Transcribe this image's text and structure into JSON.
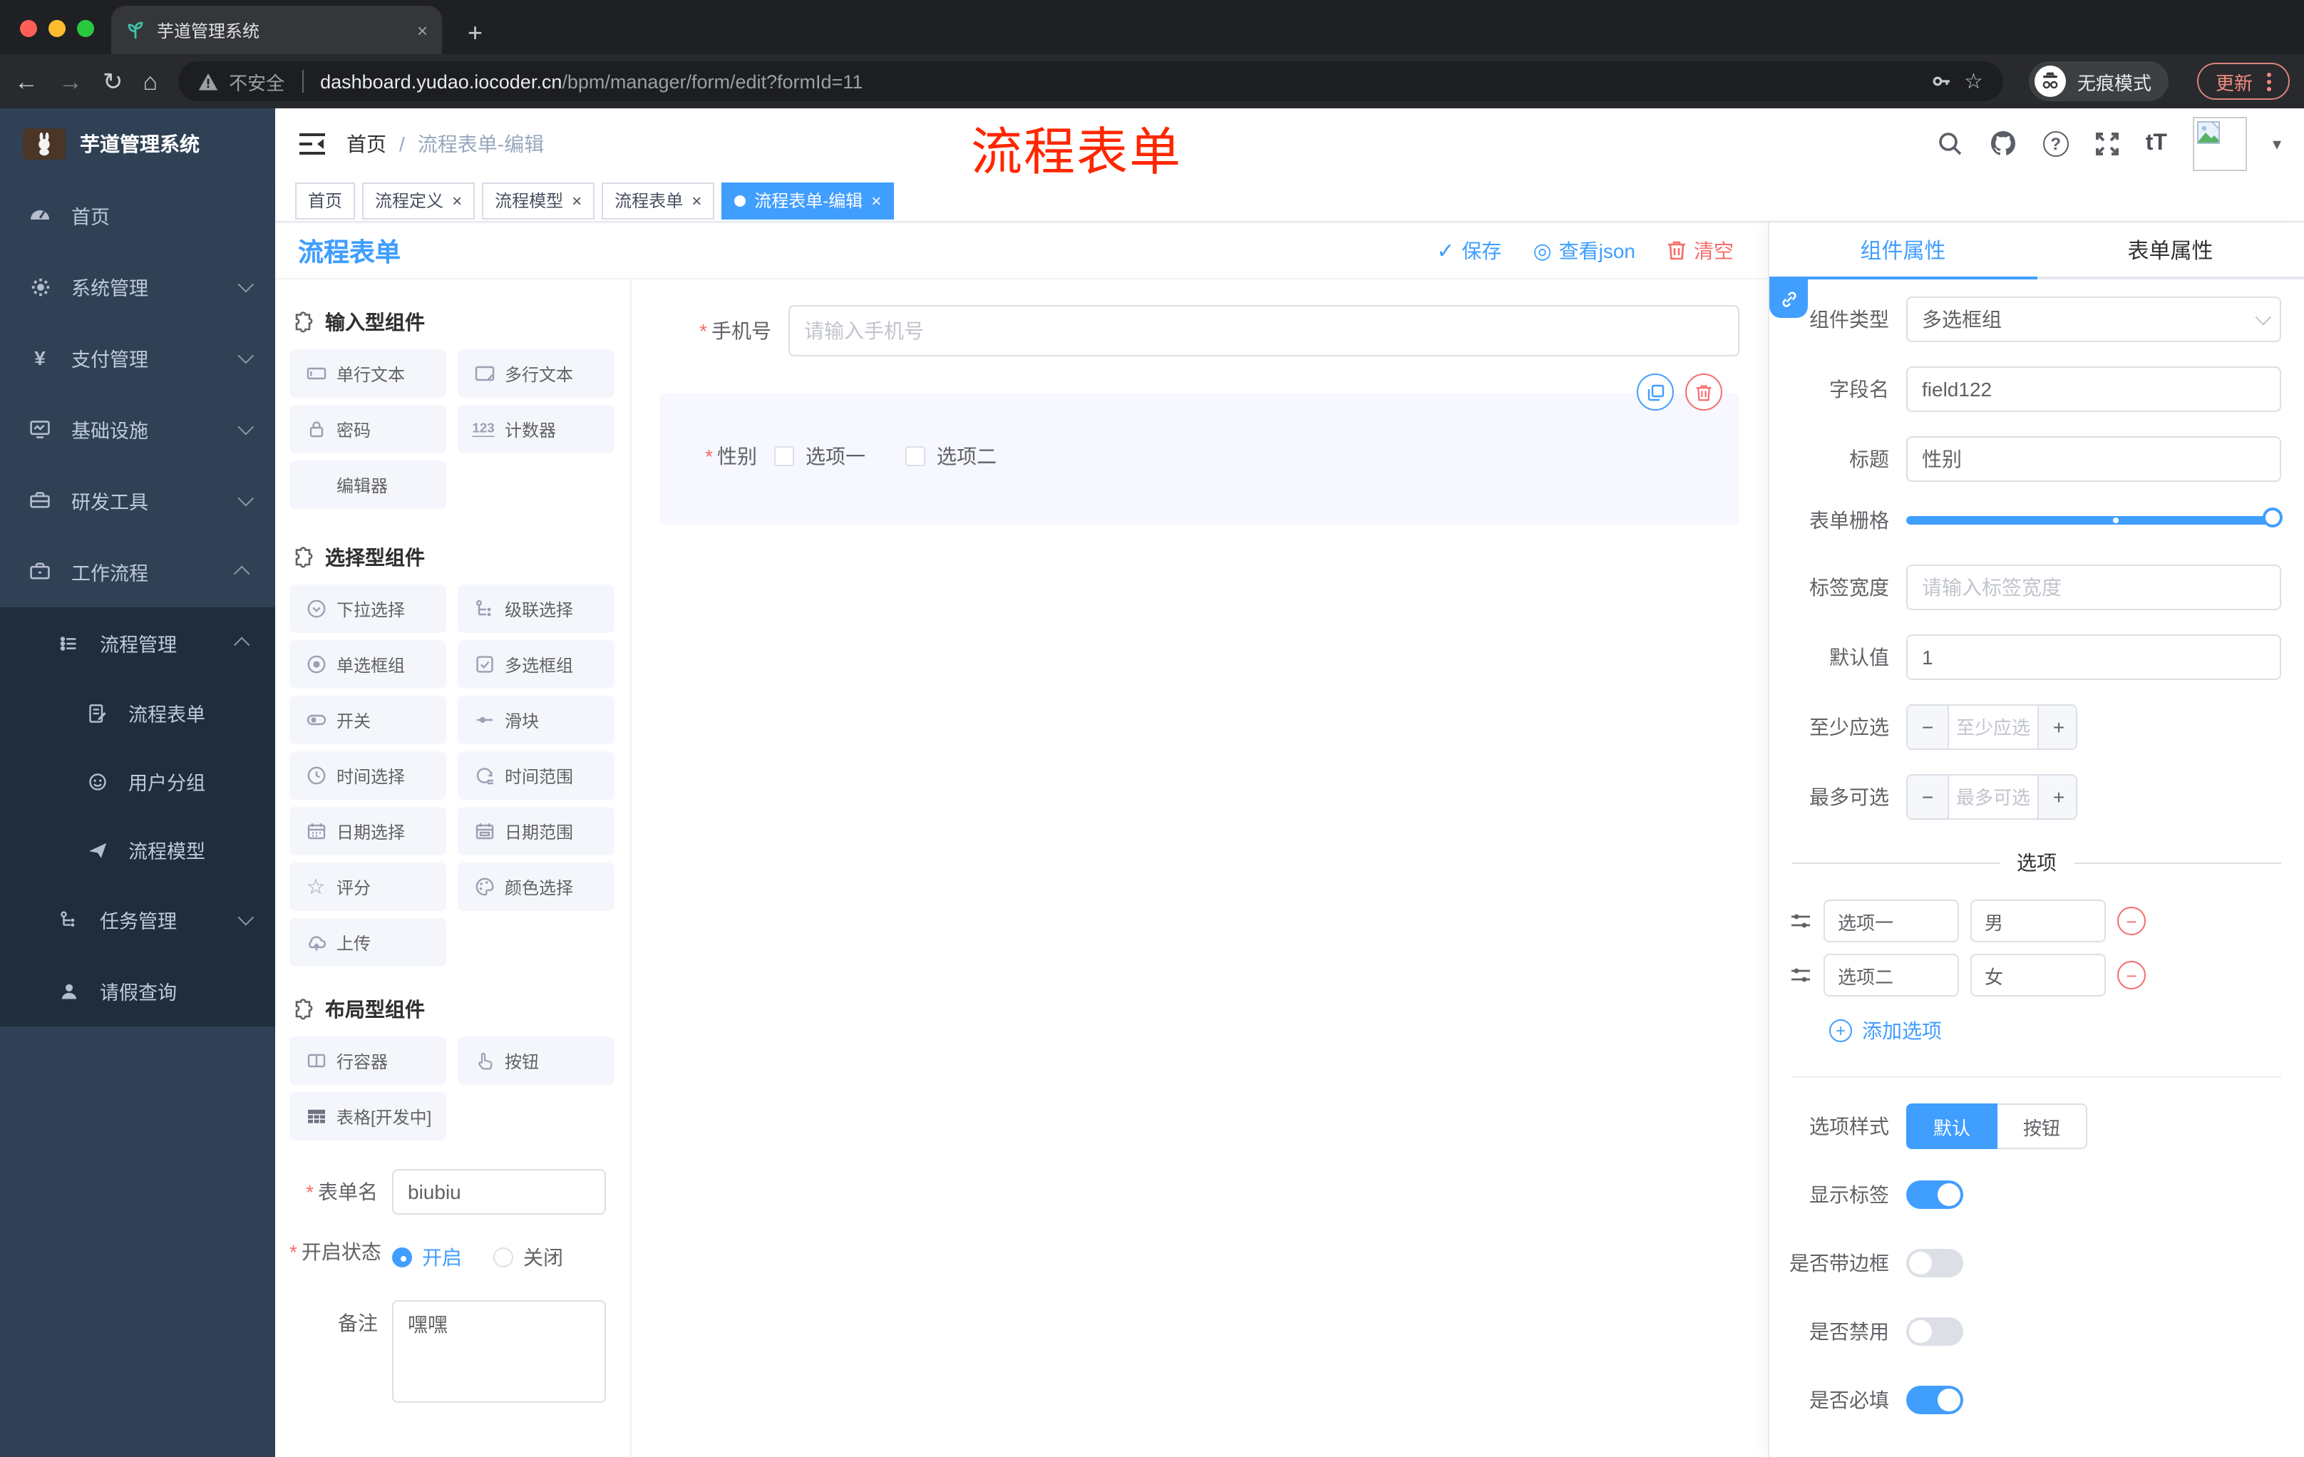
{
  "browser": {
    "tab_title": "芋道管理系统",
    "security_label": "不安全",
    "url_domain": "dashboard.yudao.iocoder.cn",
    "url_path": "/bpm/manager/form/edit?formId=11",
    "incognito_label": "无痕模式",
    "update_label": "更新"
  },
  "annotation": {
    "text": "流程表单"
  },
  "sidebar": {
    "logo_title": "芋道管理系统",
    "menu": [
      {
        "label": "首页"
      },
      {
        "label": "系统管理"
      },
      {
        "label": "支付管理"
      },
      {
        "label": "基础设施"
      },
      {
        "label": "研发工具"
      },
      {
        "label": "工作流程"
      }
    ],
    "submenu": {
      "process_manage": "流程管理",
      "children": [
        "流程表单",
        "用户分组",
        "流程模型"
      ],
      "task_manage": "任务管理",
      "leave_query": "请假查询"
    }
  },
  "header": {
    "breadcrumb": [
      "首页",
      "流程表单-编辑"
    ]
  },
  "tags": {
    "items": [
      "首页",
      "流程定义",
      "流程模型",
      "流程表单",
      "流程表单-编辑"
    ]
  },
  "designer": {
    "title": "流程表单",
    "actions": {
      "save": "保存",
      "view_json": "查看json",
      "clear": "清空"
    },
    "palette": {
      "sections": [
        {
          "title": "输入型组件",
          "items": [
            "单行文本",
            "多行文本",
            "密码",
            "计数器",
            "编辑器"
          ]
        },
        {
          "title": "选择型组件",
          "items": [
            "下拉选择",
            "级联选择",
            "单选框组",
            "多选框组",
            "开关",
            "滑块",
            "时间选择",
            "时间范围",
            "日期选择",
            "日期范围",
            "评分",
            "颜色选择",
            "上传"
          ]
        },
        {
          "title": "布局型组件",
          "items": [
            "行容器",
            "按钮",
            "表格[开发中]"
          ]
        }
      ]
    },
    "form_meta": {
      "name_label": "表单名",
      "name_value": "biubiu",
      "status_label": "开启状态",
      "status_on": "开启",
      "status_off": "关闭",
      "remark_label": "备注",
      "remark_value": "嘿嘿"
    },
    "canvas": {
      "phone_label": "手机号",
      "phone_placeholder": "请输入手机号",
      "gender_label": "性别",
      "gender_options": [
        "选项一",
        "选项二"
      ]
    }
  },
  "properties": {
    "tabs": [
      "组件属性",
      "表单属性"
    ],
    "fields": {
      "type_label": "组件类型",
      "type_value": "多选框组",
      "field_label": "字段名",
      "field_value": "field122",
      "title_label": "标题",
      "title_value": "性别",
      "grid_label": "表单栅格",
      "label_width_label": "标签宽度",
      "label_width_placeholder": "请输入标签宽度",
      "default_label": "默认值",
      "default_value": "1",
      "min_label": "至少应选",
      "min_placeholder": "至少应选",
      "max_label": "最多可选",
      "max_placeholder": "最多可选"
    },
    "options": {
      "divider": "选项",
      "rows": [
        {
          "label": "选项一",
          "value": "男"
        },
        {
          "label": "选项二",
          "value": "女"
        }
      ],
      "add_label": "添加选项"
    },
    "style": {
      "label": "选项样式",
      "options": [
        "默认",
        "按钮"
      ]
    },
    "switches": [
      {
        "label": "显示标签"
      },
      {
        "label": "是否带边框"
      },
      {
        "label": "是否禁用"
      },
      {
        "label": "是否必填"
      }
    ]
  },
  "icons": {
    "back": "←",
    "forward": "→",
    "reload": "↻",
    "home": "⌂",
    "bookmark_star": "☆",
    "key_hint": "",
    "counter": "123",
    "font_size": "tT",
    "yuan": "¥",
    "rate_star": "☆",
    "save_check": "✓",
    "view_json": "◎",
    "breadcrumb_sep": "/",
    "required": "*",
    "minus": "−",
    "plus": "+",
    "caret": "▾",
    "help": "?",
    "close": "×"
  },
  "colors": {
    "primary": "#409eff",
    "danger": "#f56c6c",
    "sidebar": "#304156",
    "submenu": "#1f2d3d",
    "annotation": "#ff2600"
  }
}
